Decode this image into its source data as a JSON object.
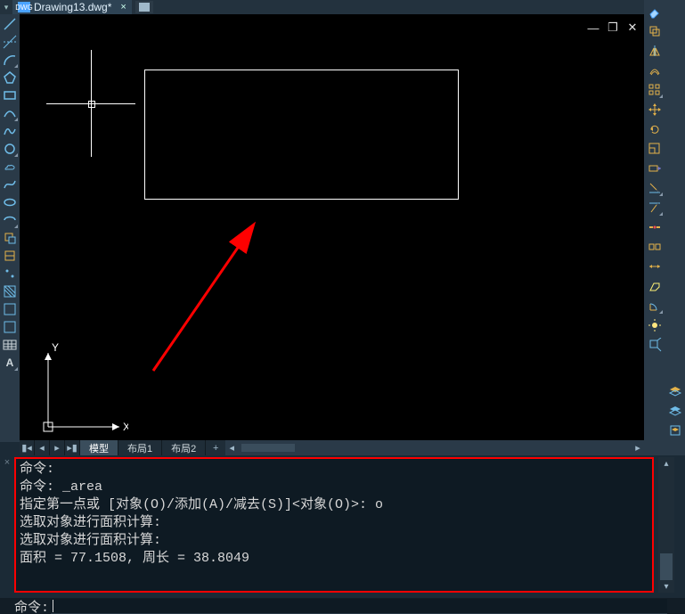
{
  "tabs": {
    "active_filename": "Drawing13.dwg*",
    "close_glyph": "×"
  },
  "window_controls": {
    "min": "—",
    "restore": "❐",
    "close": "✕"
  },
  "left_tools": [
    "line",
    "construction-line",
    "arc",
    "polygon",
    "rectangle",
    "arc3pt",
    "polyline",
    "circle",
    "revision-cloud",
    "spline",
    "ellipse",
    "ellipse-arc",
    "insert-block",
    "create-block",
    "point",
    "hatch",
    "gradient",
    "region",
    "table",
    "multiline-text"
  ],
  "right_tools_a": [
    "eraser",
    "copy-object",
    "mirror",
    "offset",
    "array",
    "move",
    "rotate",
    "scale",
    "stretch",
    "trim",
    "extend",
    "break-at-point",
    "break",
    "join",
    "chamfer",
    "fillet",
    "light",
    "explode"
  ],
  "right_tools_b": [
    "layer-manager",
    "layer-walk",
    "paste-layer"
  ],
  "layout_tabs": {
    "nav": [
      "⯇⯇",
      "⯇",
      "⯈",
      "⯈⯈"
    ],
    "model": "模型",
    "layout1": "布局1",
    "layout2": "布局2",
    "plus": "+"
  },
  "command_history": [
    "命令:",
    "命令: _area",
    "指定第一点或 [对象(O)/添加(A)/减去(S)]<对象(O)>: o",
    "选取对象进行面积计算:",
    "选取对象进行面积计算:",
    "面积 = 77.1508, 周长 = 38.8049"
  ],
  "command_prompt": "命令:",
  "ucs": {
    "x": "X",
    "y": "Y"
  },
  "colors": {
    "highlight_border": "#ff0000",
    "arrow": "#ff0000",
    "tool_icon": "#6fbce8"
  }
}
